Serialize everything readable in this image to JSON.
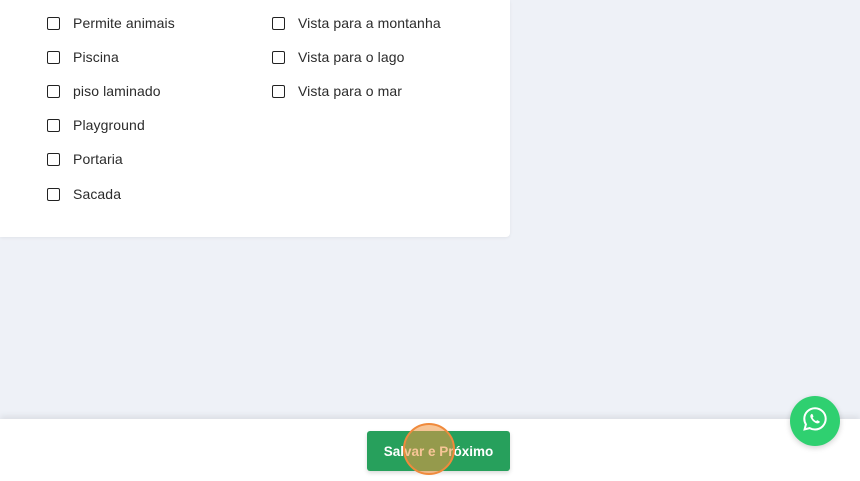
{
  "amenities": {
    "left_column": [
      {
        "label": "Permite animais",
        "checked": false
      },
      {
        "label": "Piscina",
        "checked": false
      },
      {
        "label": "piso laminado",
        "checked": false
      },
      {
        "label": "Playground",
        "checked": false
      },
      {
        "label": "Portaria",
        "checked": false
      },
      {
        "label": "Sacada",
        "checked": false
      }
    ],
    "right_column": [
      {
        "label": "Vista para a montanha",
        "checked": false
      },
      {
        "label": "Vista para o lago",
        "checked": false
      },
      {
        "label": "Vista para o mar",
        "checked": false
      }
    ]
  },
  "footer": {
    "save_next_label": "Salvar e Próximo",
    "button_color": "#27a05c"
  },
  "floating": {
    "icon": "whatsapp-icon",
    "color": "#2fd070"
  }
}
